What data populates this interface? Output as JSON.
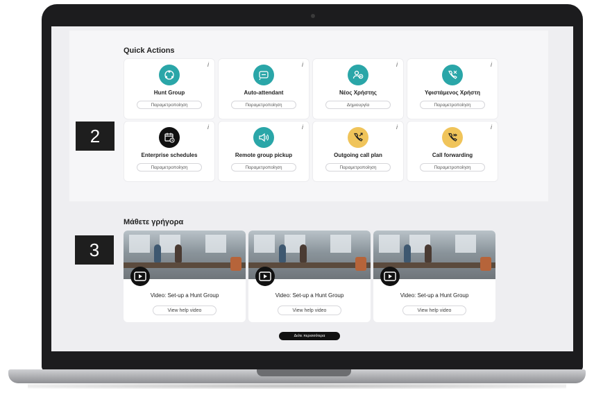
{
  "quick_actions": {
    "title": "Quick Actions",
    "info_glyph": "i",
    "cards": [
      {
        "label": "Hunt Group",
        "button": "Παραμετροποίηση",
        "icon": "hunt-group-icon",
        "color": "#2aa6a8"
      },
      {
        "label": "Auto-attendant",
        "button": "Παραμετροποίηση",
        "icon": "auto-attendant-icon",
        "color": "#2aa6a8"
      },
      {
        "label": "Νέος Χρήστης",
        "button": "Δημιουργία",
        "icon": "new-user-icon",
        "color": "#2aa6a8"
      },
      {
        "label": "Υφιστάμενος Χρήστη",
        "button": "Παραμετροποίηση",
        "icon": "existing-user-icon",
        "color": "#2aa6a8"
      },
      {
        "label": "Enterprise schedules",
        "button": "Παραμετροποίηση",
        "icon": "calendar-clock-icon",
        "color": "#111111"
      },
      {
        "label": "Remote group pickup",
        "button": "Παραμετροποίηση",
        "icon": "remote-pickup-icon",
        "color": "#2aa6a8"
      },
      {
        "label": "Outgoing call plan",
        "button": "Παραμετροποίηση",
        "icon": "outgoing-call-icon",
        "color": "#f0c45a"
      },
      {
        "label": "Call forwarding",
        "button": "Παραμετροποίηση",
        "icon": "call-forwarding-icon",
        "color": "#f0c45a"
      }
    ]
  },
  "badges": {
    "quick_actions_number": "2",
    "learn_number": "3"
  },
  "learn_quickly": {
    "title": "Μάθετε γρήγορα",
    "videos": [
      {
        "title": "Video: Set-up a Hunt Group",
        "button": "View help video",
        "icon": "play-video-icon"
      },
      {
        "title": "Video: Set-up a Hunt Group",
        "button": "View help video",
        "icon": "play-video-icon"
      },
      {
        "title": "Video: Set-up a Hunt Group",
        "button": "View help video",
        "icon": "play-video-icon"
      }
    ],
    "see_more": "Δείτε περισσότερα"
  }
}
